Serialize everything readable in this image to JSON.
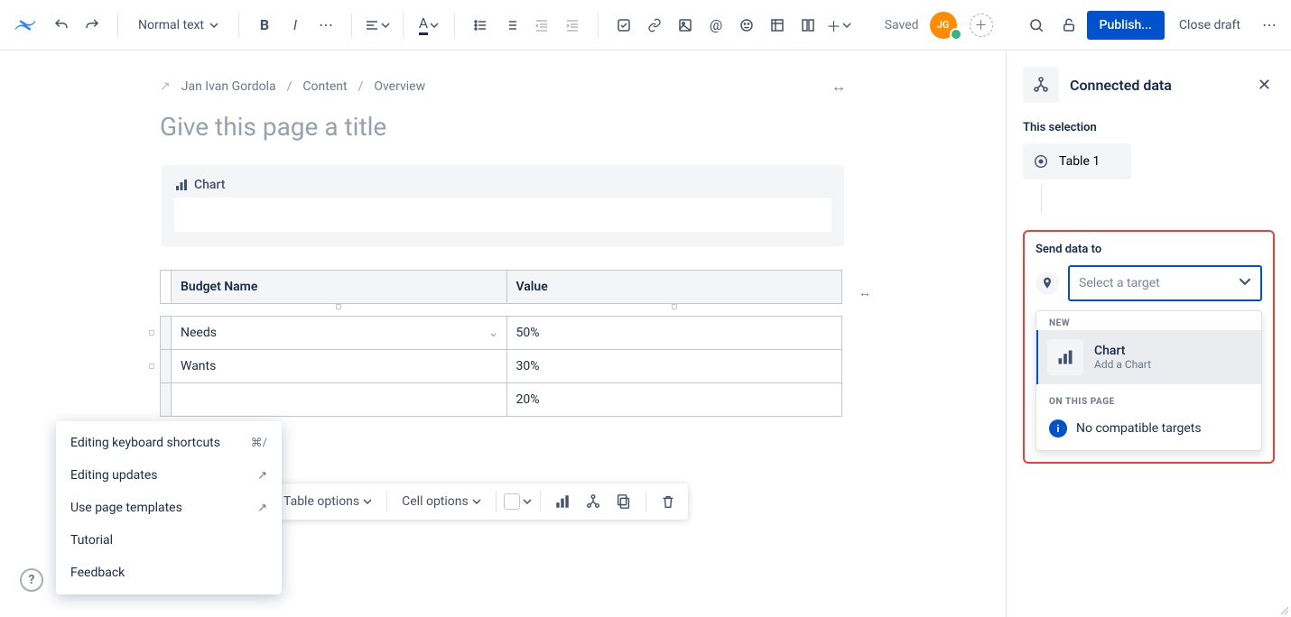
{
  "toolbar": {
    "style_dropdown": "Normal text",
    "saved": "Saved",
    "avatar": "JG",
    "publish": "Publish...",
    "close_draft": "Close draft"
  },
  "breadcrumbs": {
    "author": "Jan Ivan Gordola",
    "content": "Content",
    "overview": "Overview"
  },
  "title_placeholder": "Give this page a title",
  "chart_block_label": "Chart",
  "table": {
    "columns": [
      "Budget Name",
      "Value"
    ],
    "rows": [
      {
        "name": "Needs",
        "value": "50%"
      },
      {
        "name": "Wants",
        "value": "30%"
      },
      {
        "name": "",
        "value": "20%"
      }
    ]
  },
  "float_toolbar": {
    "table_options": "Table options",
    "cell_options": "Cell options"
  },
  "help_popup": {
    "shortcuts": "Editing keyboard shortcuts",
    "shortcuts_key": "⌘/",
    "updates": "Editing updates",
    "templates": "Use page templates",
    "tutorial": "Tutorial",
    "feedback": "Feedback"
  },
  "sidepanel": {
    "title": "Connected data",
    "this_selection": "This selection",
    "selection_label": "Table 1",
    "send_data_to": "Send data to",
    "target_placeholder": "Select a target",
    "dd_section_new": "NEW",
    "dd_opt_title": "Chart",
    "dd_opt_desc": "Add a Chart",
    "dd_on_page": "ON THIS PAGE",
    "no_compatible": "No compatible targets"
  }
}
